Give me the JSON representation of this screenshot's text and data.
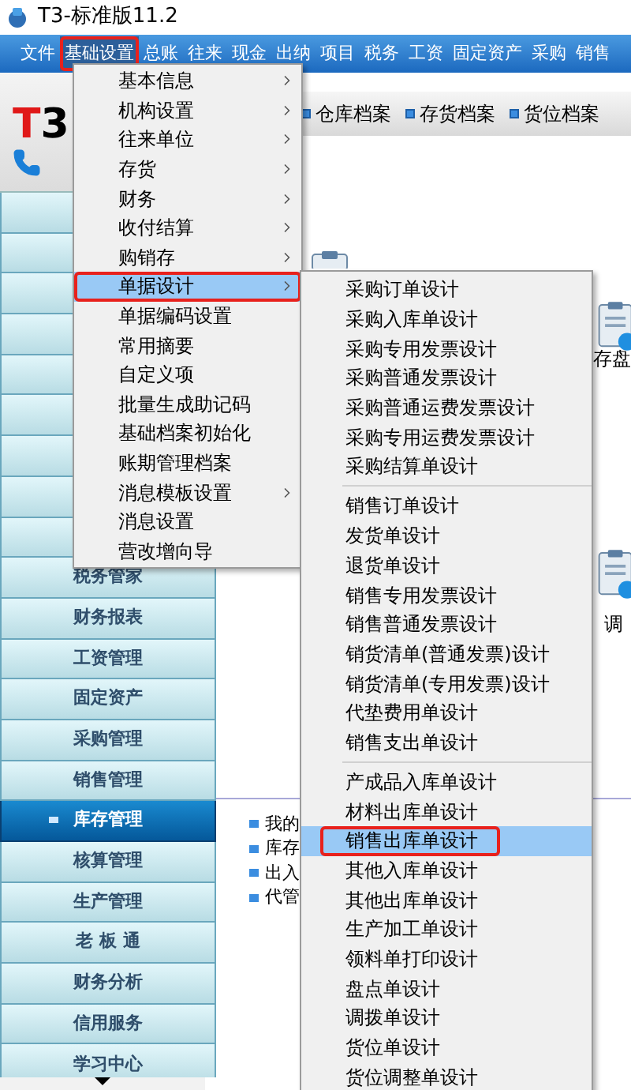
{
  "window": {
    "title": "T3-标准版11.2"
  },
  "menu_bar": [
    {
      "label": "文件",
      "selected": false,
      "outlined": false
    },
    {
      "label": "基础设置",
      "selected": true,
      "outlined": true
    },
    {
      "label": "总账",
      "selected": false,
      "outlined": false
    },
    {
      "label": "往来",
      "selected": false,
      "outlined": false
    },
    {
      "label": "现金",
      "selected": false,
      "outlined": false
    },
    {
      "label": "出纳",
      "selected": false,
      "outlined": false
    },
    {
      "label": "项目",
      "selected": false,
      "outlined": false
    },
    {
      "label": "税务",
      "selected": false,
      "outlined": false
    },
    {
      "label": "工资",
      "selected": false,
      "outlined": false
    },
    {
      "label": "固定资产",
      "selected": false,
      "outlined": false
    },
    {
      "label": "采购",
      "selected": false,
      "outlined": false
    },
    {
      "label": "销售",
      "selected": false,
      "outlined": false
    }
  ],
  "logo": "T3",
  "toolbar": [
    "仓库档案",
    "存货档案",
    "货位档案"
  ],
  "sidebar": {
    "items": [
      {
        "selected": false
      },
      {
        "selected": false
      },
      {
        "selected": false
      },
      {
        "selected": false
      },
      {
        "selected": false
      },
      {
        "selected": false
      },
      {
        "selected": false
      },
      {
        "selected": false
      },
      {
        "selected": false
      },
      {
        "label": "税务管家",
        "selected": false
      },
      {
        "label": "财务报表",
        "selected": false
      },
      {
        "label": "工资管理",
        "selected": false
      },
      {
        "label": "固定资产",
        "selected": false
      },
      {
        "label": "采购管理",
        "selected": false
      },
      {
        "label": "销售管理",
        "selected": false
      },
      {
        "label": "库存管理",
        "selected": true
      },
      {
        "label": "核算管理",
        "selected": false
      },
      {
        "label": "生产管理",
        "selected": false
      },
      {
        "label": "老 板 通",
        "selected": false
      },
      {
        "label": "财务分析",
        "selected": false
      },
      {
        "label": "信用服务",
        "selected": false
      },
      {
        "label": "学习中心",
        "selected": false
      }
    ]
  },
  "content": {
    "shortcut_labels": [
      "存盘",
      "调"
    ],
    "task_list": [
      "我的",
      "库存",
      "出入",
      "代管"
    ]
  },
  "dropdown_menu": {
    "items": [
      {
        "label": "基本信息",
        "submenu": true,
        "selected": false,
        "outlined": false
      },
      {
        "label": "机构设置",
        "submenu": true,
        "selected": false,
        "outlined": false
      },
      {
        "label": "往来单位",
        "submenu": true,
        "selected": false,
        "outlined": false
      },
      {
        "label": "存货",
        "submenu": true,
        "selected": false,
        "outlined": false
      },
      {
        "label": "财务",
        "submenu": true,
        "selected": false,
        "outlined": false
      },
      {
        "label": "收付结算",
        "submenu": true,
        "selected": false,
        "outlined": false
      },
      {
        "label": "购销存",
        "submenu": true,
        "selected": false,
        "outlined": false
      },
      {
        "label": "单据设计",
        "submenu": true,
        "selected": true,
        "outlined": true
      },
      {
        "label": "单据编码设置",
        "submenu": false,
        "selected": false,
        "outlined": false
      },
      {
        "label": "常用摘要",
        "submenu": false,
        "selected": false,
        "outlined": false
      },
      {
        "label": "自定义项",
        "submenu": false,
        "selected": false,
        "outlined": false
      },
      {
        "label": "批量生成助记码",
        "submenu": false,
        "selected": false,
        "outlined": false
      },
      {
        "label": "基础档案初始化",
        "submenu": false,
        "selected": false,
        "outlined": false
      },
      {
        "label": "账期管理档案",
        "submenu": false,
        "selected": false,
        "outlined": false
      },
      {
        "label": "消息模板设置",
        "submenu": true,
        "selected": false,
        "outlined": false
      },
      {
        "label": "消息设置",
        "submenu": false,
        "selected": false,
        "outlined": false
      },
      {
        "label": "营改增向导",
        "submenu": false,
        "selected": false,
        "outlined": false
      }
    ]
  },
  "submenu": {
    "groups": [
      [
        {
          "label": "采购订单设计",
          "selected": false,
          "outlined": false
        },
        {
          "label": "采购入库单设计",
          "selected": false,
          "outlined": false
        },
        {
          "label": "采购专用发票设计",
          "selected": false,
          "outlined": false
        },
        {
          "label": "采购普通发票设计",
          "selected": false,
          "outlined": false
        },
        {
          "label": "采购普通运费发票设计",
          "selected": false,
          "outlined": false
        },
        {
          "label": "采购专用运费发票设计",
          "selected": false,
          "outlined": false
        },
        {
          "label": "采购结算单设计",
          "selected": false,
          "outlined": false
        }
      ],
      [
        {
          "label": "销售订单设计",
          "selected": false,
          "outlined": false
        },
        {
          "label": "发货单设计",
          "selected": false,
          "outlined": false
        },
        {
          "label": "退货单设计",
          "selected": false,
          "outlined": false
        },
        {
          "label": "销售专用发票设计",
          "selected": false,
          "outlined": false
        },
        {
          "label": "销售普通发票设计",
          "selected": false,
          "outlined": false
        },
        {
          "label": "销货清单(普通发票)设计",
          "selected": false,
          "outlined": false
        },
        {
          "label": "销货清单(专用发票)设计",
          "selected": false,
          "outlined": false
        },
        {
          "label": "代垫费用单设计",
          "selected": false,
          "outlined": false
        },
        {
          "label": "销售支出单设计",
          "selected": false,
          "outlined": false
        }
      ],
      [
        {
          "label": "产成品入库单设计",
          "selected": false,
          "outlined": false
        },
        {
          "label": "材料出库单设计",
          "selected": false,
          "outlined": false
        },
        {
          "label": "销售出库单设计",
          "selected": true,
          "outlined": true
        },
        {
          "label": "其他入库单设计",
          "selected": false,
          "outlined": false
        },
        {
          "label": "其他出库单设计",
          "selected": false,
          "outlined": false
        },
        {
          "label": "生产加工单设计",
          "selected": false,
          "outlined": false
        },
        {
          "label": "领料单打印设计",
          "selected": false,
          "outlined": false
        },
        {
          "label": "盘点单设计",
          "selected": false,
          "outlined": false
        },
        {
          "label": "调拨单设计",
          "selected": false,
          "outlined": false
        },
        {
          "label": "货位单设计",
          "selected": false,
          "outlined": false
        },
        {
          "label": "货位调整单设计",
          "selected": false,
          "outlined": false
        }
      ]
    ]
  }
}
